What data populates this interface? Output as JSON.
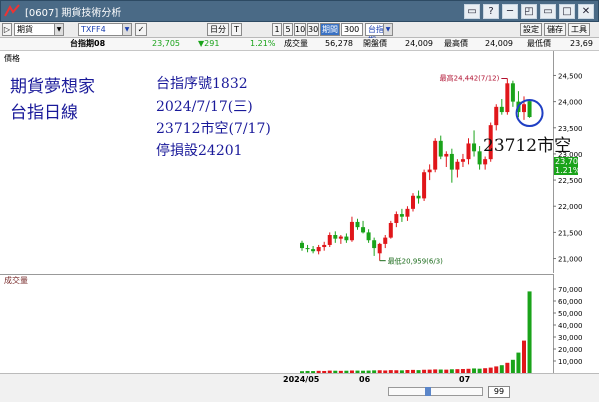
{
  "window": {
    "title": "[0607] 期貨技術分析",
    "controls": [
      "▭",
      "?",
      "─",
      "◰",
      "▭",
      "□",
      "✕"
    ]
  },
  "toolbar": {
    "market": "期貨",
    "symbol": "TXFF4",
    "checkbox": "✓",
    "period": "日分",
    "t_btn": "T",
    "intervals": [
      "1",
      "5",
      "10",
      "30"
    ],
    "active_interval": "期間",
    "count": "300",
    "indicator": "台指期",
    "right_buttons": [
      "設定",
      "儲存",
      "工具"
    ]
  },
  "quote": {
    "name": "台指期08",
    "price": "23,705",
    "change": "▼291",
    "change_pct": "1.21%",
    "volume_label": "成交量",
    "volume": "56,278",
    "open_label": "開盤價",
    "open": "24,009",
    "high_label": "最高價",
    "high": "24,009",
    "low_label": "最低價",
    "low": "23,69"
  },
  "chart": {
    "price_label": "價格",
    "volume_label": "成交量",
    "high_marker": "最高24,442(7/12)",
    "low_marker": "最低20,959(6/3)",
    "last_price_tag": "23,705",
    "last_pct_tag": "1.21%",
    "x_labels": [
      "2024/05",
      "06",
      "07"
    ],
    "zoom_value": "99"
  },
  "annotations": {
    "brand": "期貨夢想家",
    "subtitle": "台指日線",
    "serial": "台指序號1832",
    "date": "2024/7/17(三)",
    "entry": "23712市空(7/17)",
    "stop": "停損設24201",
    "right_note": "23712市空"
  },
  "colors": {
    "up": "#e0161a",
    "down": "#1aa31a",
    "annotation_text": "#1a1a9a",
    "circle": "#1f3fc4",
    "title_bar": "#4a6a86",
    "active_button": "#3a72c4"
  },
  "chart_data": [
    {
      "type": "candlestick",
      "ylim": [
        20800,
        24700
      ],
      "yticks": [
        21000,
        21500,
        22000,
        22500,
        23000,
        23500,
        24000,
        24500
      ],
      "ytick_labels": [
        "21,000",
        "21,500",
        "22,000",
        "22,500",
        "23,000",
        "23,500",
        "24,000",
        "24,500"
      ],
      "candles": [
        {
          "o": 21300,
          "h": 21340,
          "l": 21150,
          "c": 21200
        },
        {
          "o": 21200,
          "h": 21260,
          "l": 21120,
          "c": 21180
        },
        {
          "o": 21180,
          "h": 21240,
          "l": 21100,
          "c": 21140
        },
        {
          "o": 21140,
          "h": 21260,
          "l": 21080,
          "c": 21220
        },
        {
          "o": 21220,
          "h": 21320,
          "l": 21150,
          "c": 21260
        },
        {
          "o": 21260,
          "h": 21500,
          "l": 21220,
          "c": 21450
        },
        {
          "o": 21450,
          "h": 21520,
          "l": 21300,
          "c": 21380
        },
        {
          "o": 21380,
          "h": 21450,
          "l": 21280,
          "c": 21420
        },
        {
          "o": 21420,
          "h": 21480,
          "l": 21300,
          "c": 21350
        },
        {
          "o": 21350,
          "h": 21800,
          "l": 21320,
          "c": 21700
        },
        {
          "o": 21700,
          "h": 21760,
          "l": 21550,
          "c": 21600
        },
        {
          "o": 21600,
          "h": 21720,
          "l": 21480,
          "c": 21500
        },
        {
          "o": 21500,
          "h": 21560,
          "l": 21300,
          "c": 21350
        },
        {
          "o": 21350,
          "h": 21400,
          "l": 21050,
          "c": 21200
        },
        {
          "o": 21100,
          "h": 21300,
          "l": 20959,
          "c": 21280
        },
        {
          "o": 21280,
          "h": 21450,
          "l": 21200,
          "c": 21400
        },
        {
          "o": 21400,
          "h": 21720,
          "l": 21380,
          "c": 21680
        },
        {
          "o": 21680,
          "h": 21900,
          "l": 21600,
          "c": 21850
        },
        {
          "o": 21850,
          "h": 21950,
          "l": 21700,
          "c": 21800
        },
        {
          "o": 21800,
          "h": 22000,
          "l": 21720,
          "c": 21950
        },
        {
          "o": 21950,
          "h": 22250,
          "l": 21900,
          "c": 22200
        },
        {
          "o": 22200,
          "h": 22300,
          "l": 22050,
          "c": 22150
        },
        {
          "o": 22150,
          "h": 22700,
          "l": 22100,
          "c": 22650
        },
        {
          "o": 22650,
          "h": 22800,
          "l": 22500,
          "c": 22700
        },
        {
          "o": 22700,
          "h": 23300,
          "l": 22650,
          "c": 23250
        },
        {
          "o": 23250,
          "h": 23350,
          "l": 22900,
          "c": 22950
        },
        {
          "o": 22950,
          "h": 23050,
          "l": 22750,
          "c": 23000
        },
        {
          "o": 23000,
          "h": 23100,
          "l": 22450,
          "c": 22700
        },
        {
          "o": 22700,
          "h": 22900,
          "l": 22550,
          "c": 22850
        },
        {
          "o": 22850,
          "h": 23000,
          "l": 22750,
          "c": 22900
        },
        {
          "o": 22900,
          "h": 23300,
          "l": 22800,
          "c": 23200
        },
        {
          "o": 23200,
          "h": 23450,
          "l": 22950,
          "c": 23050
        },
        {
          "o": 23050,
          "h": 23150,
          "l": 22700,
          "c": 22800
        },
        {
          "o": 22800,
          "h": 22950,
          "l": 22700,
          "c": 22900
        },
        {
          "o": 22900,
          "h": 23600,
          "l": 22850,
          "c": 23550
        },
        {
          "o": 23550,
          "h": 23950,
          "l": 23450,
          "c": 23900
        },
        {
          "o": 23900,
          "h": 24050,
          "l": 23750,
          "c": 23800
        },
        {
          "o": 23800,
          "h": 24442,
          "l": 23750,
          "c": 24350
        },
        {
          "o": 24350,
          "h": 24400,
          "l": 23900,
          "c": 24000
        },
        {
          "o": 24000,
          "h": 24200,
          "l": 23700,
          "c": 23800
        },
        {
          "o": 23800,
          "h": 24100,
          "l": 23650,
          "c": 23950
        },
        {
          "o": 24009,
          "h": 24009,
          "l": 23690,
          "c": 23705
        }
      ]
    },
    {
      "type": "bar",
      "ylim": [
        0,
        75000
      ],
      "yticks": [
        10000,
        20000,
        30000,
        40000,
        50000,
        60000,
        70000
      ],
      "ytick_labels": [
        "10,000",
        "20,000",
        "30,000",
        "40,000",
        "50,000",
        "60,000",
        "70,000"
      ],
      "values": [
        1500,
        1700,
        1600,
        1800,
        1700,
        2000,
        1900,
        1800,
        1900,
        2100,
        2000,
        1900,
        2000,
        2200,
        2300,
        2100,
        2400,
        2300,
        2200,
        2500,
        2600,
        2400,
        2700,
        2800,
        3000,
        2900,
        2800,
        3100,
        3200,
        3300,
        3500,
        3800,
        3600,
        4000,
        4500,
        5500,
        6500,
        8500,
        11000,
        17000,
        27000,
        68000
      ]
    }
  ]
}
